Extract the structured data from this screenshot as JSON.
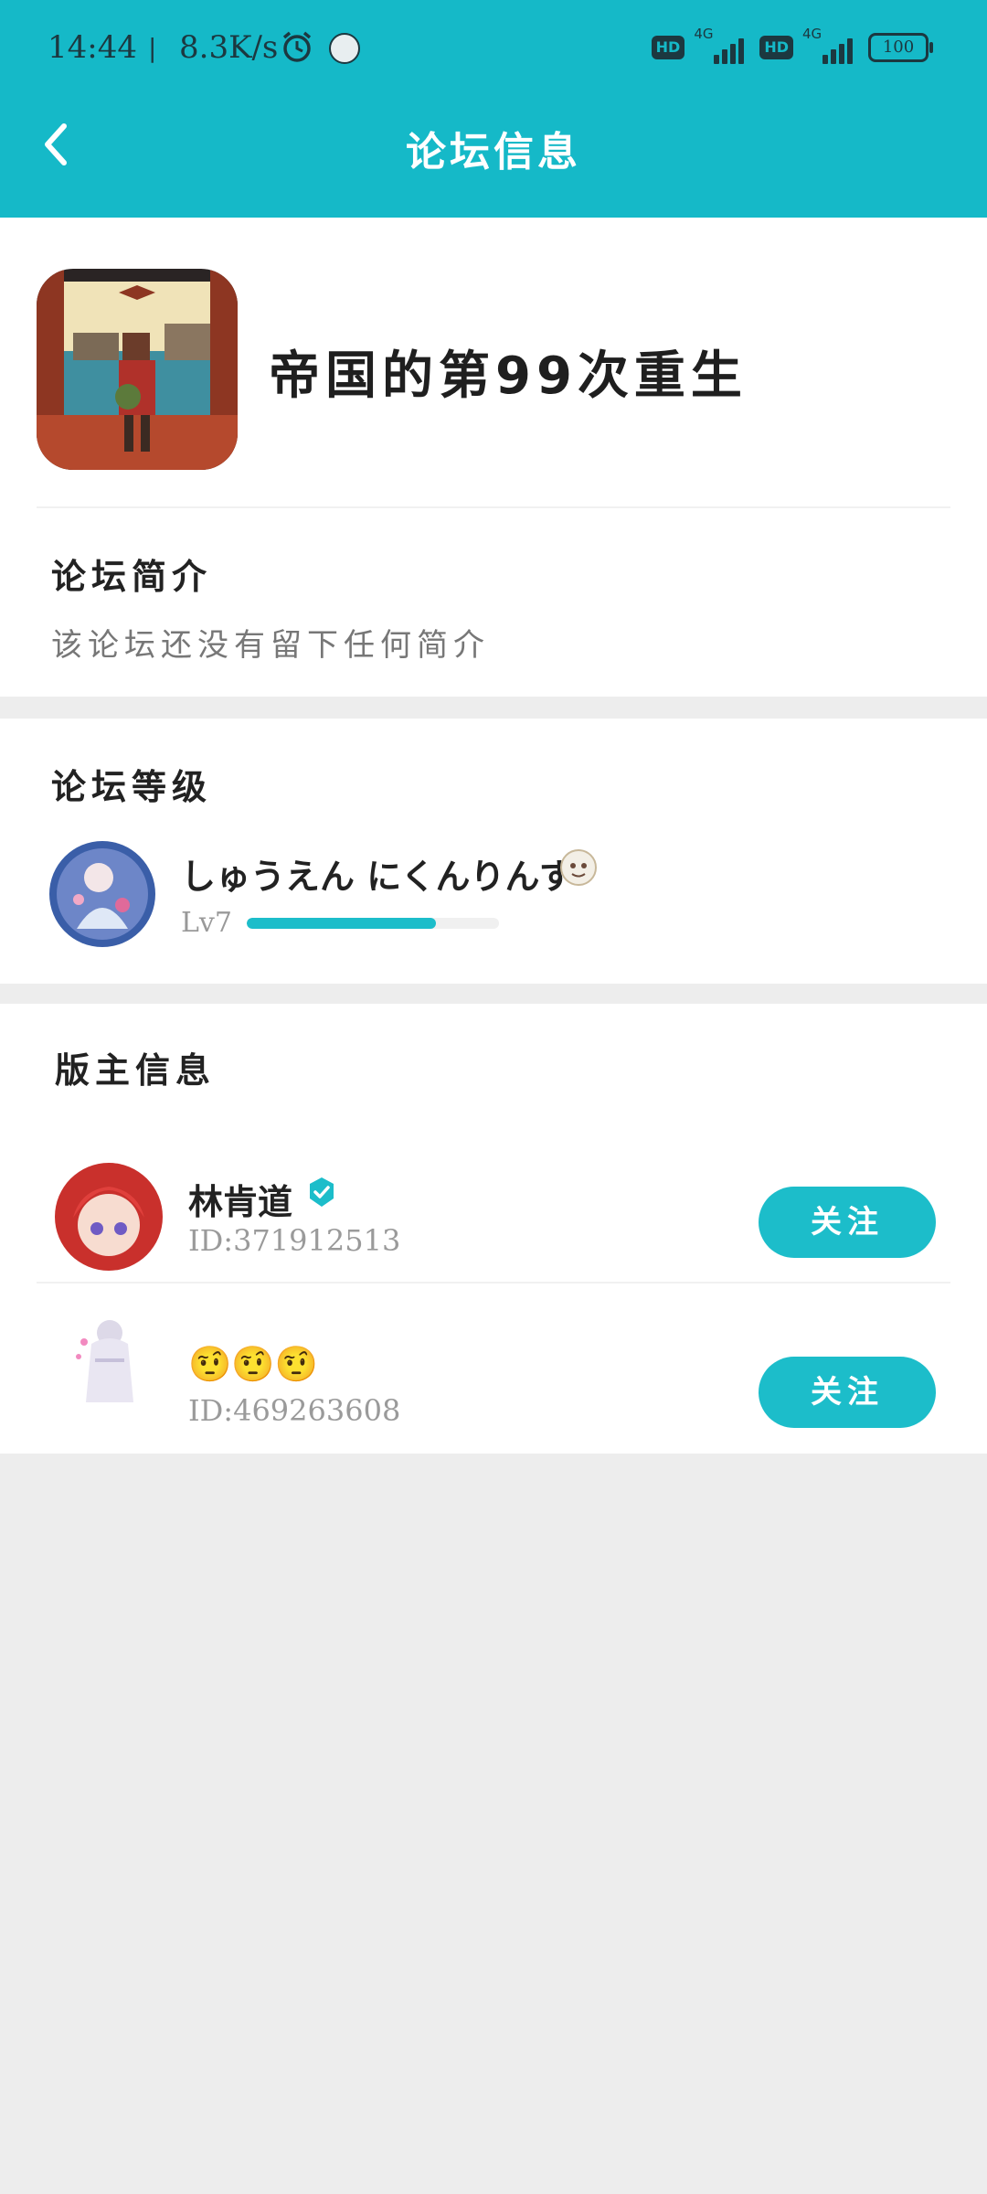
{
  "status_bar": {
    "time": "14:44",
    "separator": "|",
    "speed": "8.3K/s",
    "hd1": "HD",
    "net1": "4G",
    "hd2": "HD",
    "net2": "4G",
    "battery": "100"
  },
  "header": {
    "title": "论坛信息"
  },
  "forum": {
    "name": "帝国的第99次重生"
  },
  "intro": {
    "title": "论坛简介",
    "text": "该论坛还没有留下任何简介"
  },
  "level": {
    "title": "论坛等级",
    "user_name": "しゅうえん にくんりんす",
    "level_label": "Lv7",
    "progress": 0.75
  },
  "moderators": {
    "title": "版主信息",
    "items": [
      {
        "name": "林肯道",
        "id": "ID:371912513",
        "follow_label": "关注"
      },
      {
        "name": "🤨🤨🤨",
        "id": "ID:469263608",
        "follow_label": "关注"
      }
    ]
  },
  "colors": {
    "accent": "#15b9c8",
    "button": "#1cbdca",
    "background": "#ededed"
  },
  "icons": {
    "back": "chevron-left-icon",
    "alarm": "alarm-icon",
    "verified": "verified-badge-icon"
  }
}
